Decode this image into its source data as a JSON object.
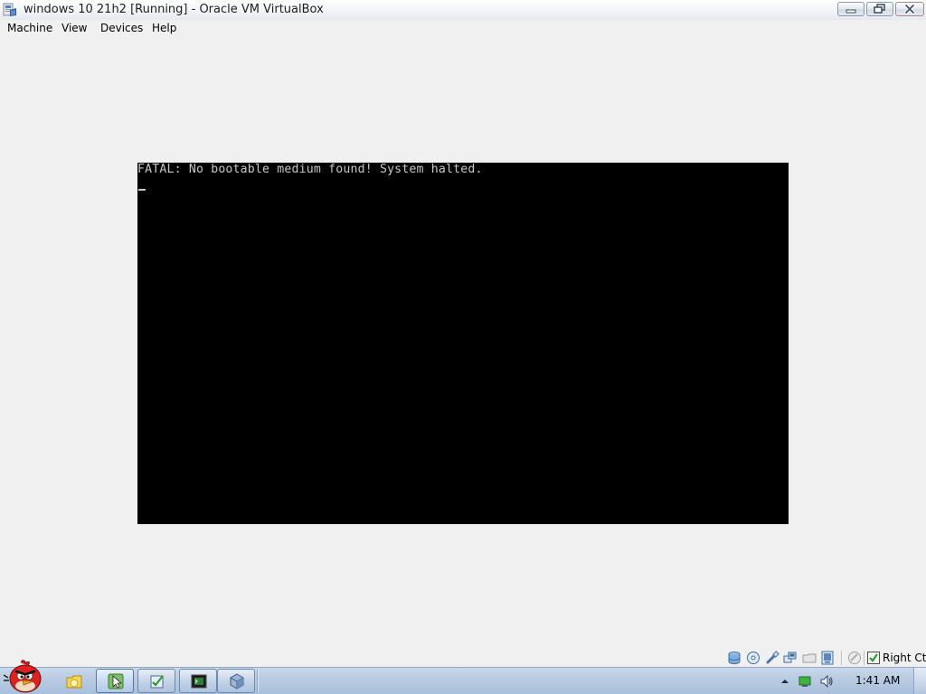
{
  "window": {
    "title": "windows 10 21h2 [Running] - Oracle VM VirtualBox",
    "icon": "virtualbox-icon",
    "controls": [
      "minimize-icon",
      "restore-icon",
      "close-icon"
    ]
  },
  "menubar": {
    "items": [
      {
        "label": "Machine"
      },
      {
        "label": "View"
      },
      {
        "label": "Devices"
      },
      {
        "label": "Help"
      }
    ]
  },
  "vm_screen": {
    "message": "FATAL: No bootable medium found! System halted.",
    "cursor": "_"
  },
  "statusbar": {
    "icons": [
      "hard-disk-icon",
      "optical-drive-icon",
      "usb-icon",
      "network-icon",
      "shared-folders-icon",
      "display-icon",
      "video-capture-icon",
      "mouse-integration-icon",
      "keyboard-capture-icon"
    ],
    "host_key": "Right Ctrl"
  },
  "taskbar": {
    "start_icon": "angry-bird-icon",
    "pinned": [
      "explorer-folder-icon",
      "cursor-app-icon",
      "checklist-app-icon",
      "terminal-icon",
      "virtualbox-cube-icon"
    ],
    "tray": [
      "show-hidden-icons-icon",
      "network-status-icon",
      "volume-icon"
    ],
    "clock": "1:41 AM"
  },
  "colors": {
    "console_text": "#c6c6c6",
    "console_background": "#000000",
    "chrome_background": "#f0f0f0",
    "taskbar": "#b8cbe2"
  }
}
